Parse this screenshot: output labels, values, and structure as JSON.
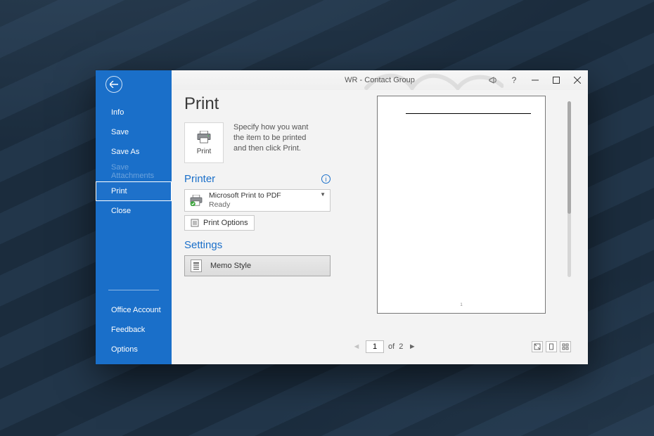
{
  "window": {
    "title": "WR  -  Contact Group"
  },
  "sidebar": {
    "items": [
      {
        "label": "Info"
      },
      {
        "label": "Save"
      },
      {
        "label": "Save As"
      },
      {
        "label": "Save Attachments"
      },
      {
        "label": "Print"
      },
      {
        "label": "Close"
      }
    ],
    "footer": [
      {
        "label": "Office Account"
      },
      {
        "label": "Feedback"
      },
      {
        "label": "Options"
      }
    ]
  },
  "page": {
    "title": "Print",
    "print_button_label": "Print",
    "description": "Specify how you want the item to be printed and then click Print."
  },
  "printer": {
    "section": "Printer",
    "name": "Microsoft Print to PDF",
    "status": "Ready",
    "options_button": "Print Options"
  },
  "settings": {
    "section": "Settings",
    "style": "Memo Style"
  },
  "pager": {
    "current": "1",
    "of_label": "of",
    "total": "2"
  },
  "preview": {
    "page_number": "1"
  }
}
